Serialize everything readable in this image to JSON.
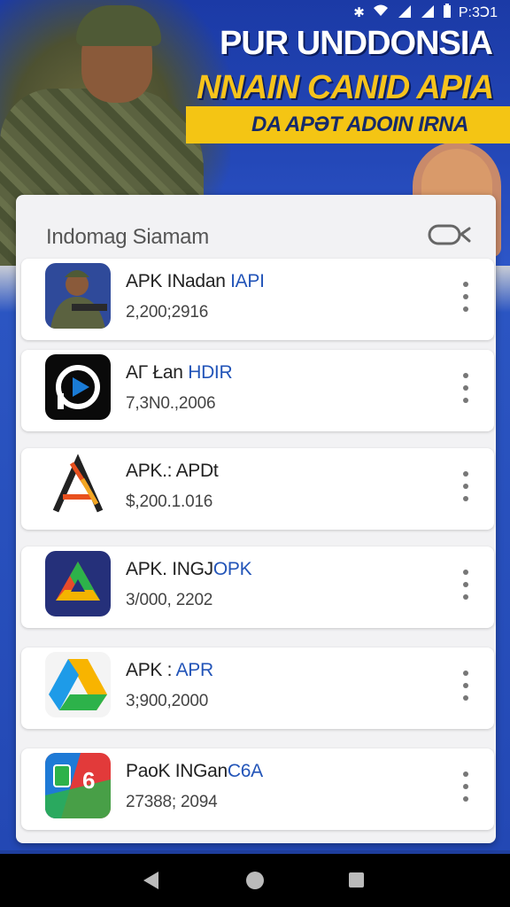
{
  "status_bar": {
    "time": "P:3Ↄ1"
  },
  "banner": {
    "title_line1": "PUR UNDDONSIA",
    "title_line2": "NNAIN CANID APIA",
    "tagline": "DA APƏT ADOIN ΙRNA"
  },
  "dialog": {
    "title": "Indomag Siamam",
    "apps": [
      {
        "name": "APK INadan",
        "name_accent": "IAPI",
        "count": "2,200;2916",
        "icon": "soldier-app-icon"
      },
      {
        "name": "AΓ Łan",
        "name_accent": "HDIR",
        "count": "7,3N0.,2006",
        "icon": "play-app-icon"
      },
      {
        "name": "APK.: APDt",
        "name_accent": "",
        "count": "$,200.1.016",
        "icon": "letter-a-app-icon"
      },
      {
        "name": "APK. INGJ",
        "name_accent": "OPK",
        "count": "3/000, 2202",
        "icon": "triangle-app-icon"
      },
      {
        "name": "APK :",
        "name_accent": "APR",
        "count": "3;900,2000",
        "icon": "drive-app-icon"
      },
      {
        "name": "PaoK INGan",
        "name_accent": "C6A",
        "count": "27388; 2094",
        "icon": "map-app-icon"
      }
    ]
  }
}
